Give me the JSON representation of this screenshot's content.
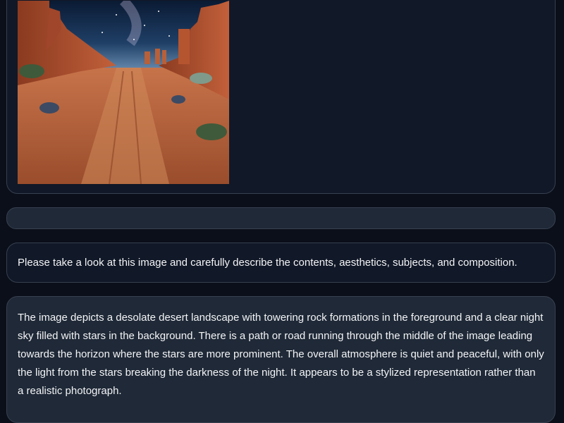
{
  "chat": {
    "image_message": {
      "image_alt": "desert canyon landscape under a starry night sky"
    },
    "input_bar": {
      "placeholder": ""
    },
    "user_message": {
      "text": "Please take a look at this image and carefully describe the contents, aesthetics, subjects, and composition."
    },
    "assistant_message": {
      "text": "The image depicts a desolate desert landscape with towering rock formations in the foreground and a clear night sky filled with stars in the background. There is a path or road running through the middle of the image leading towards the horizon where the stars are more prominent. The overall atmosphere is quiet and peaceful, with only the light from the stars breaking the darkness of the night. It appears to be a stylized representation rather than a realistic photograph."
    }
  },
  "colors": {
    "background": "#0b0f19",
    "card": "#111827",
    "card_alt": "#1f2937",
    "border": "#374151",
    "text": "#f3f4f6"
  }
}
